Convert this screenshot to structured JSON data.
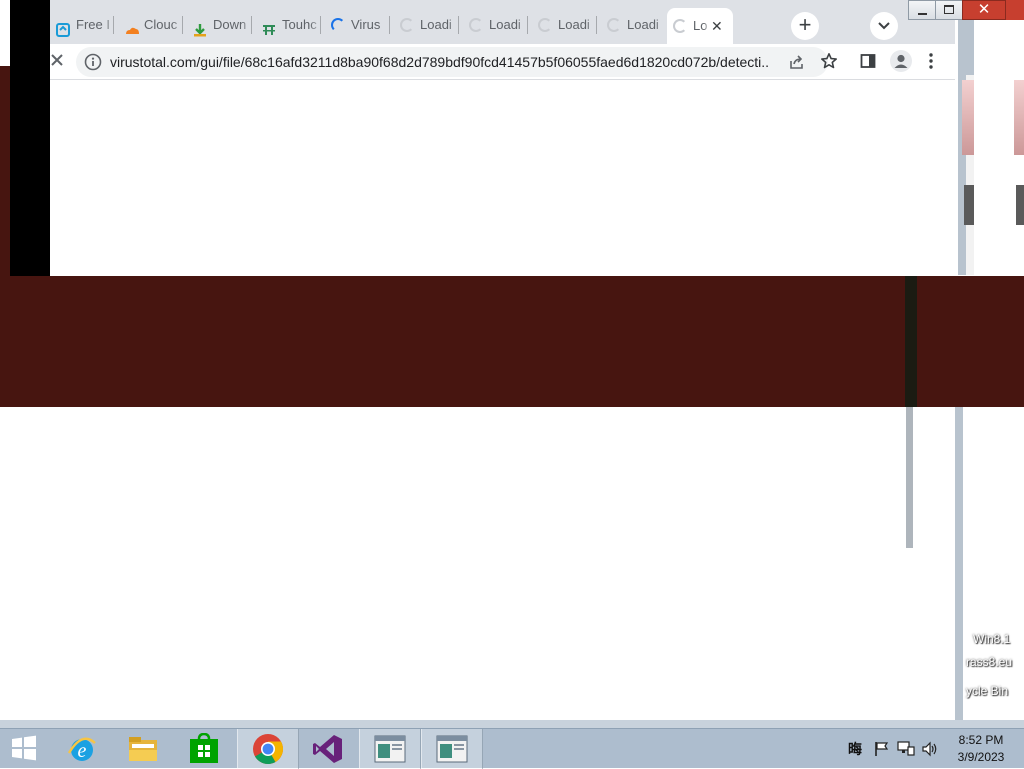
{
  "browser": {
    "tabs": [
      {
        "title": "Free I",
        "icon": "free-site-icon",
        "state": "loaded"
      },
      {
        "title": "Clouc",
        "icon": "cloudflare-icon",
        "state": "loaded"
      },
      {
        "title": "Down",
        "icon": "download-icon",
        "state": "loaded"
      },
      {
        "title": "Touhc",
        "icon": "touhou-icon",
        "state": "loaded"
      },
      {
        "title": "Virus",
        "icon": "loading-spinner-icon",
        "state": "loading"
      },
      {
        "title": "Loadi",
        "icon": "loading-spinner-icon",
        "state": "loading"
      },
      {
        "title": "Loadi",
        "icon": "loading-spinner-icon",
        "state": "loading"
      },
      {
        "title": "Loadi",
        "icon": "loading-spinner-icon",
        "state": "loading"
      },
      {
        "title": "Loadi",
        "icon": "loading-spinner-icon",
        "state": "loading"
      },
      {
        "title": "Lo",
        "icon": "loading-spinner-icon",
        "state": "loading",
        "active": true
      }
    ],
    "new_tab_label": "+",
    "close_tab_label": "✕",
    "address_bar": {
      "url": "virustotal.com/gui/file/68c16afd3211d8ba90f68d2d789bdf90fcd41457b5f06055faed6d1820cd072b/detecti..."
    },
    "window_controls": {
      "close_label": "✕"
    }
  },
  "taskbar": {
    "pinned": [
      {
        "name": "start-button",
        "icon": "windows-logo-icon"
      },
      {
        "name": "internet-explorer",
        "icon": "internet-explorer-icon"
      },
      {
        "name": "file-explorer",
        "icon": "file-explorer-icon"
      },
      {
        "name": "store",
        "icon": "store-icon"
      },
      {
        "name": "chrome",
        "icon": "chrome-icon",
        "running": true
      },
      {
        "name": "visual-studio",
        "icon": "visual-studio-icon"
      },
      {
        "name": "window-app-1",
        "icon": "window-app-icon",
        "running": true
      },
      {
        "name": "window-app-2",
        "icon": "window-app-icon",
        "running": true
      }
    ],
    "tray": {
      "ime": "晦",
      "icons": [
        "action-center-flag-icon",
        "network-icon",
        "volume-icon"
      ]
    },
    "clock": {
      "time": "8:52 PM",
      "date": "3/9/2023"
    }
  },
  "desktop": {
    "icon_labels": [
      "Win8.1",
      "rass8.eu",
      "ycle Bin"
    ]
  },
  "colors": {
    "glitch_band": "#471510",
    "tab_strip": "#dee1e6",
    "taskbar": "#adbdce",
    "close_button": "#c73f2f"
  }
}
